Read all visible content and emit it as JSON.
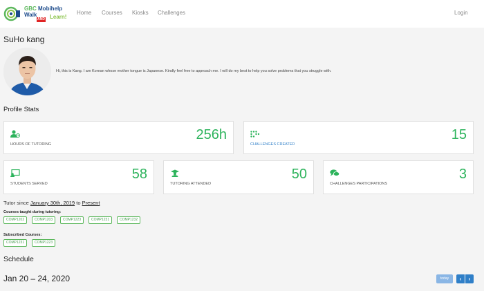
{
  "colors": {
    "accent": "#2cb35b",
    "link": "#2f7fc8",
    "brand_blue": "#1e4c8c",
    "brand_red": "#e02424"
  },
  "nav": {
    "logo": {
      "line1": "GBC Mobihelp",
      "line2": "Walk",
      "and": "AND",
      "line3": "Learn!"
    },
    "links": [
      "Home",
      "Courses",
      "Kiosks",
      "Challenges"
    ],
    "login": "Login"
  },
  "profile": {
    "name": "SuHo kang",
    "bio": "Hi, this is Kang. I am Korean whose mother tongue is Japanese. Kindly feel free to approach me. I will do my best to help you solve problems that you struggle with."
  },
  "stats_title": "Profile Stats",
  "stats": [
    {
      "icon": "user-clock-icon",
      "label": "HOURS OF TUTORING",
      "value": "256h"
    },
    {
      "icon": "dots-grid-icon",
      "label": "CHALLENGES CREATED",
      "value": "15"
    },
    {
      "icon": "chalkboard-icon",
      "label": "STUDENTS SERVED",
      "value": "58"
    },
    {
      "icon": "graduation-cap-icon",
      "label": "TUTORING ATTENDED",
      "value": "50"
    },
    {
      "icon": "comments-icon",
      "label": "CHALLENGES PARTICIPATIONS",
      "value": "3"
    }
  ],
  "tutor_since": {
    "prefix": "Tutor since",
    "start": "January 30th, 2019",
    "to": "to",
    "end": "Present"
  },
  "courses_taught_title": "Courses taught during tutoring:",
  "courses_taught": [
    "COMP1202",
    "COMP1203",
    "COMP1223",
    "COMP1231",
    "COMP1232"
  ],
  "subscribed_title": "Subscribed Courses:",
  "subscribed": [
    "COMP1231",
    "COMP1223"
  ],
  "schedule": {
    "title": "Schedule",
    "range": "Jan 20 – 24, 2020",
    "today": "today",
    "prev": "‹",
    "next": "›"
  }
}
